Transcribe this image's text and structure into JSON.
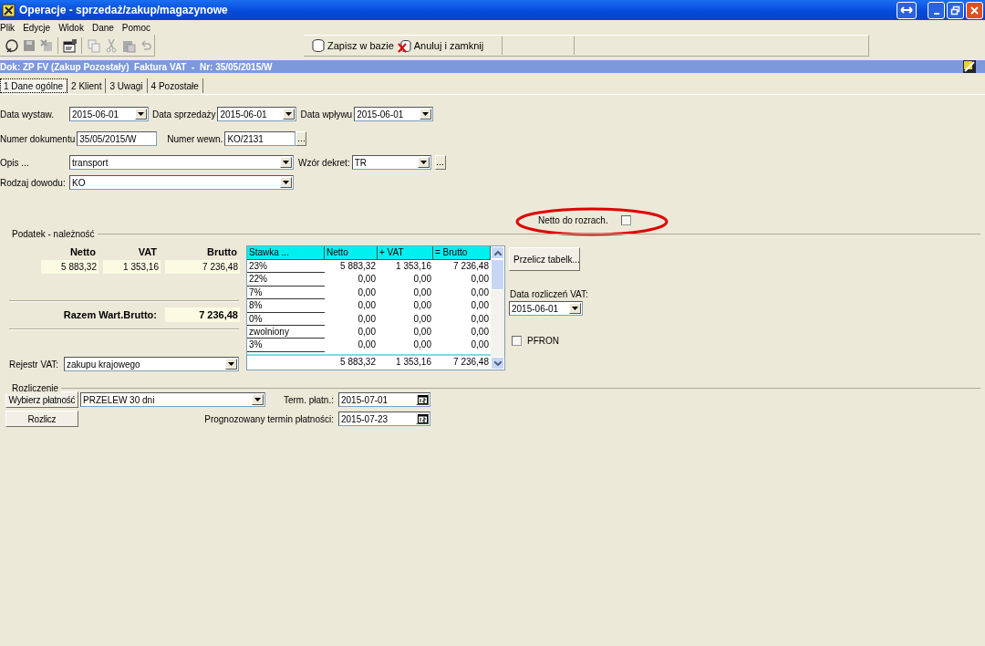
{
  "window": {
    "title": "Operacje - sprzedaż/zakup/magazynowe"
  },
  "menu": [
    "Plik",
    "Edycje",
    "Widok",
    "Dane",
    "Pomoc"
  ],
  "toolbar": {
    "actions": [
      "Zapisz w bazie",
      "Anuluj i zamknij"
    ]
  },
  "document_header": "Dok: ZP FV (Zakup Pozostały)  Faktura VAT  -  Nr: 35/05/2015/W",
  "tabs": [
    {
      "label": "1 Dane ogólne",
      "selected": true
    },
    {
      "label": "2 Klient",
      "selected": false
    },
    {
      "label": "3 Uwagi",
      "selected": false
    },
    {
      "label": "4 Pozostałe",
      "selected": false
    }
  ],
  "general": {
    "issue_date": {
      "label": "Data wystaw.",
      "value": "2015-06-01"
    },
    "sale_date": {
      "label": "Data sprzedaży",
      "value": "2015-06-01"
    },
    "receipt_date": {
      "label": "Data wpływu",
      "value": "2015-06-01"
    },
    "document_number": {
      "label": "Numer dokumentu",
      "value": "35/05/2015/W"
    },
    "internal_number": {
      "label": "Numer wewn.",
      "value": "KO/2131"
    },
    "description": {
      "label": "Opis ...",
      "value": "transport"
    },
    "posting_template": {
      "label": "Wzór dekret:",
      "value": "TR"
    },
    "proof_type": {
      "label": "Rodzaj dowodu:",
      "value": "KO"
    }
  },
  "net_settlement": {
    "label": "Netto do rozrach.",
    "checked": false,
    "circled": true
  },
  "tax": {
    "title": "Podatek - należność",
    "totals": [
      {
        "label": "Netto",
        "value": "5 883,32"
      },
      {
        "label": "VAT",
        "value": "1 353,16"
      },
      {
        "label": "Brutto",
        "value": "7 236,48"
      }
    ],
    "gross_total": {
      "label": "Razem Wart.Brutto:",
      "value": "7 236,48"
    },
    "vat_register": {
      "label": "Rejestr VAT:",
      "value": "zakupu krajowego"
    }
  },
  "rates_table": {
    "columns": [
      "Stawka ...",
      "Netto",
      "+ VAT",
      "= Brutto"
    ],
    "rows": [
      {
        "rate": "23%",
        "net": "5 883,32",
        "vat": "1 353,16",
        "gross": "7 236,48"
      },
      {
        "rate": "22%",
        "net": "0,00",
        "vat": "0,00",
        "gross": "0,00"
      },
      {
        "rate": "7%",
        "net": "0,00",
        "vat": "0,00",
        "gross": "0,00"
      },
      {
        "rate": "8%",
        "net": "0,00",
        "vat": "0,00",
        "gross": "0,00"
      },
      {
        "rate": "0%",
        "net": "0,00",
        "vat": "0,00",
        "gross": "0,00"
      },
      {
        "rate": "zwolniony",
        "net": "0,00",
        "vat": "0,00",
        "gross": "0,00"
      },
      {
        "rate": "3%",
        "net": "0,00",
        "vat": "0,00",
        "gross": "0,00"
      }
    ],
    "footer": {
      "net": "5 883,32",
      "vat": "1 353,16",
      "gross": "7 236,48"
    }
  },
  "recalculate_button": "Przelicz tabelk...",
  "vat_settlement_date": {
    "label": "Data rozliczeń VAT:",
    "value": "2015-06-01"
  },
  "pfron": {
    "label": "PFRON",
    "checked": false
  },
  "settlement": {
    "title": "Rozliczenie",
    "choose_payment_button": "Wybierz płatność",
    "payment_method": "PRZELEW 30 dni",
    "settle_button": "Rozlicz",
    "payment_term": {
      "label": "Term. płatn.:",
      "value": "2015-07-01"
    },
    "forecast_term": {
      "label": "Prognozowany termin płatności:",
      "value": "2015-07-23"
    }
  }
}
